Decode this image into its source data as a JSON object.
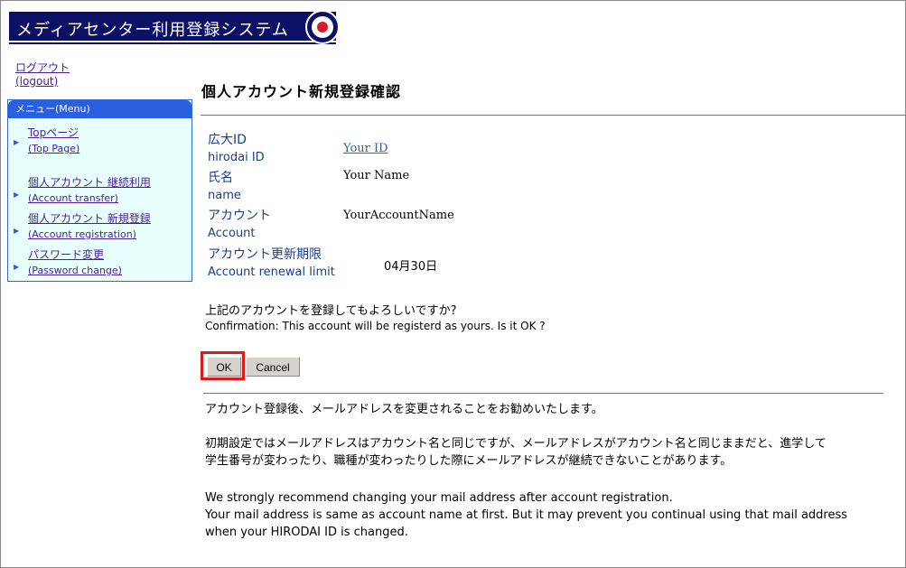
{
  "header": {
    "title": "メディアセンター利用登録システム"
  },
  "logout": {
    "label_ja": "ログアウト",
    "label_en": "(logout)"
  },
  "menu": {
    "title": "メニュー(Menu)",
    "items": [
      {
        "label_ja": "Topページ",
        "label_en": "(Top Page)"
      },
      {
        "label_ja": "個人アカウント 継続利用",
        "label_en": "(Account transfer)"
      },
      {
        "label_ja": "個人アカウント 新規登録",
        "label_en": "(Account registration)"
      },
      {
        "label_ja": "パスワード変更",
        "label_en": "(Password change)"
      }
    ]
  },
  "page": {
    "title": "個人アカウント新規登録確認"
  },
  "fields": [
    {
      "label_ja": "広大ID",
      "label_en": "hirodai ID",
      "value": "Your ID"
    },
    {
      "label_ja": "氏名",
      "label_en": "name",
      "value": "Your Name"
    },
    {
      "label_ja": "アカウント",
      "label_en": "Account",
      "value": "YourAccountName"
    },
    {
      "label_ja": "アカウント更新期限",
      "label_en": "Account renewal limit",
      "value": "04月30日"
    }
  ],
  "confirm": {
    "ja": "上記のアカウントを登録してもよろしいですか?",
    "en": "Confirmation: This account will be registerd as yours. Is it OK ?"
  },
  "buttons": {
    "ok": "OK",
    "cancel": "Cancel"
  },
  "notes": {
    "line1": "アカウント登録後、メールアドレスを変更されることをお勧めいたします。",
    "line2": "初期設定ではメールアドレスはアカウント名と同じですが、メールアドレスがアカウント名と同じままだと、進学して",
    "line3": "学生番号が変わったり、職種が変わったりした際にメールアドレスが継続できないことがあります。",
    "en1": "We strongly recommend changing your mail address after account registration.",
    "en2": "Your mail address is same as account name at first. But it may prevent you continual using that mail address",
    "en3": "when your HIRODAI ID is changed."
  }
}
